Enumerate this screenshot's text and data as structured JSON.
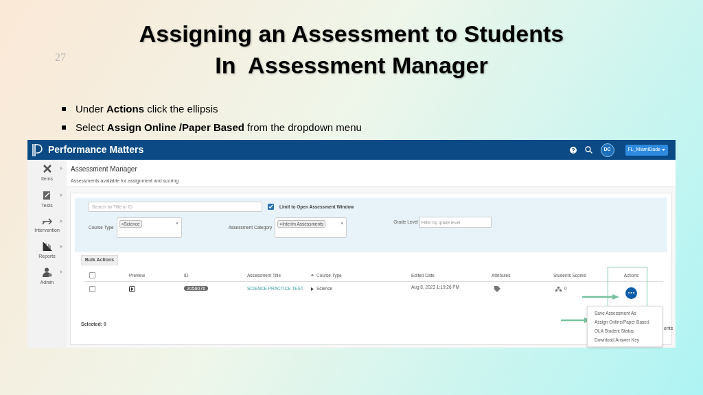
{
  "slide": {
    "number": "27",
    "title_lines": [
      "Assigning an Assessment to Students",
      "In  Assessment Manager"
    ],
    "bullets": [
      "Under **Actions** click the ellipsis",
      "Select **Assign Online /Paper Based** from the dropdown menu"
    ]
  },
  "app": {
    "brand": "Performance Matters",
    "avatar": "DC",
    "district": "FL_MiamiDade",
    "sidebar": [
      {
        "label": "Items"
      },
      {
        "label": "Tests"
      },
      {
        "label": "Intervention"
      },
      {
        "label": "Reports"
      },
      {
        "label": "Admin"
      }
    ],
    "page_title": "Assessment Manager",
    "page_subtitle": "Assessments available for assignment and scoring",
    "filters": {
      "search_placeholder": "Search by Title or ID",
      "limit": {
        "label": "Limit to Open Assessment Window",
        "checked": true
      },
      "course_type": {
        "label": "Course Type",
        "tags": [
          {
            "remove": "×",
            "label": "Science"
          }
        ],
        "clear": "×"
      },
      "category": {
        "label": "Assessment Category",
        "tags": [
          {
            "remove": "×",
            "label": "Interim Assessments"
          }
        ],
        "clear": "×"
      },
      "grade": {
        "label": "Grade Level",
        "placeholder": "Filter by grade level"
      }
    },
    "bulk_actions": "Bulk Actions",
    "table": {
      "header_checked": false,
      "columns": [
        "Preview",
        "ID",
        "Assessment Title",
        "Course Type",
        "Edited Date",
        "Attributes",
        "Students Scored",
        "Actions"
      ],
      "rows": [
        {
          "checked": false,
          "id": "2058076",
          "title": "SCIENCE PRACTICE TEST",
          "course_type": "Science",
          "edited": "Aug 8, 2023 1:19:26 PM",
          "students_scored": "0"
        }
      ]
    },
    "selected_count": "Selected: 0",
    "menu": [
      "Save Assessment As",
      "Assign Online/Paper Based",
      "OLA Student Status",
      "Download Answer Key"
    ],
    "covered_text": "ents"
  }
}
